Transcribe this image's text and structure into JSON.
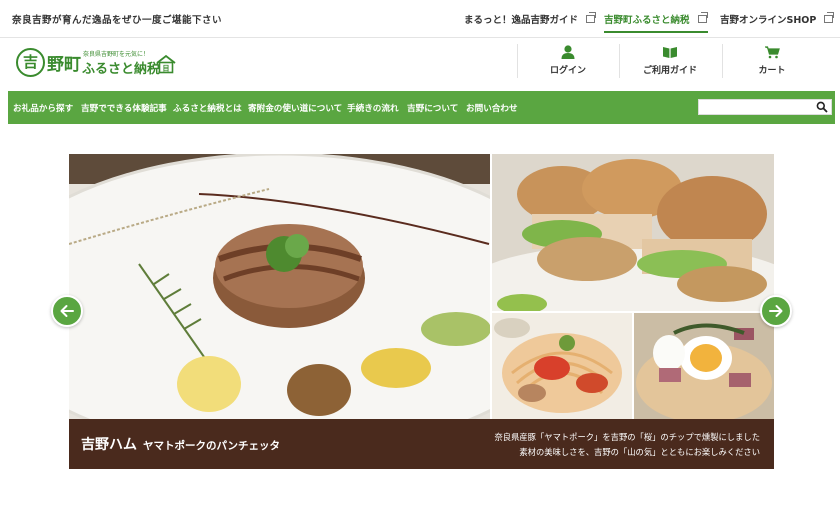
{
  "tagline": "奈良吉野が育んだ逸品をぜひ一度ご堪能下さい",
  "top_links": [
    {
      "label": "まるっと！逸品吉野ガイド",
      "icon": "external-link-icon"
    },
    {
      "label": "吉野町ふるさと納税",
      "icon": "external-link-icon",
      "active": true
    },
    {
      "label": "吉野オンラインSHOP",
      "icon": "external-link-icon"
    }
  ],
  "logo": {
    "circle": "吉",
    "town": "野町",
    "sub": "奈良県吉野町を元気に！",
    "main": "ふるさと納税",
    "house_text": "目"
  },
  "header_items": [
    {
      "label": "ログイン",
      "icon": "user-icon"
    },
    {
      "label": "ご利用ガイド",
      "icon": "book-icon"
    },
    {
      "label": "カート",
      "icon": "cart-icon"
    }
  ],
  "nav": [
    "お礼品から探す",
    "吉野でできる体験記事",
    "ふるさと納税とは",
    "寄附金の使い道について",
    "手続きの流れ",
    "吉野について",
    "お問い合わせ"
  ],
  "search": {
    "placeholder": "",
    "value": ""
  },
  "slide": {
    "title": "吉野ハム",
    "subtitle": "ヤマトポークのパンチェッタ",
    "desc_line1": "奈良県産豚「ヤマトポーク」を吉野の「桜」のチップで燻製にしました",
    "desc_line2": "素材の美味しさを、吉野の「山の気」とともにお楽しみください"
  },
  "colors": {
    "brand_green": "#3a8b2e",
    "nav_green": "#5aa641",
    "caption_brown": "#4a2a1d"
  }
}
